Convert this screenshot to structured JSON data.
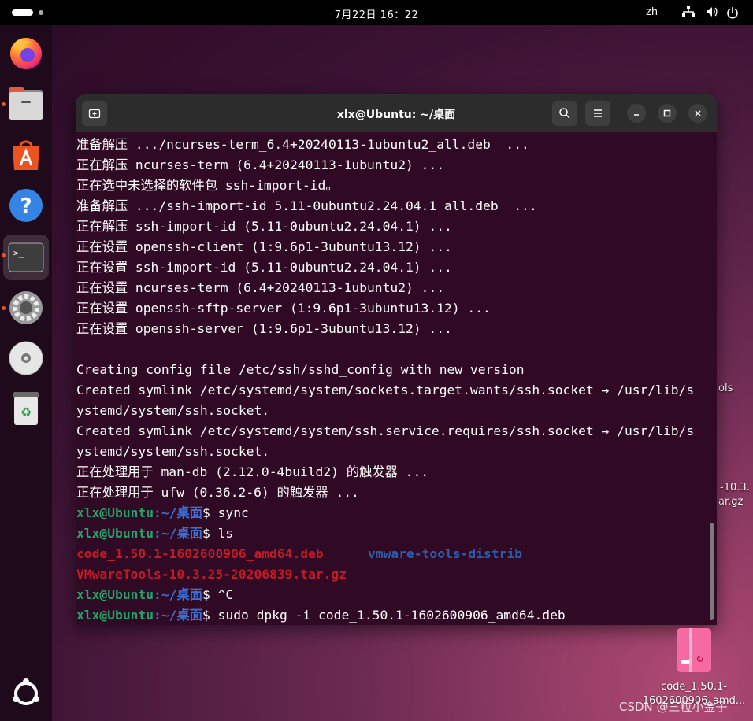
{
  "topbar": {
    "clock": "7月22日  16：22",
    "language": "zh"
  },
  "dock": {
    "items": [
      {
        "name": "firefox",
        "running": false
      },
      {
        "name": "files",
        "running": true
      },
      {
        "name": "app-center",
        "running": false
      },
      {
        "name": "help",
        "running": false
      },
      {
        "name": "terminal",
        "running": true,
        "active": true
      },
      {
        "name": "settings",
        "running": true
      },
      {
        "name": "disc",
        "running": false
      },
      {
        "name": "trash",
        "running": false
      }
    ]
  },
  "terminal": {
    "title": "xlx@Ubuntu: ~/桌面",
    "prompt_user": "xlx@Ubuntu",
    "prompt_path": ":~/桌面",
    "lines": [
      "准备解压 .../ncurses-term_6.4+20240113-1ubuntu2_all.deb  ...",
      "正在解压 ncurses-term (6.4+20240113-1ubuntu2) ...",
      "正在选中未选择的软件包 ssh-import-id。",
      "准备解压 .../ssh-import-id_5.11-0ubuntu2.24.04.1_all.deb  ...",
      "正在解压 ssh-import-id (5.11-0ubuntu2.24.04.1) ...",
      "正在设置 openssh-client (1:9.6p1-3ubuntu13.12) ...",
      "正在设置 ssh-import-id (5.11-0ubuntu2.24.04.1) ...",
      "正在设置 ncurses-term (6.4+20240113-1ubuntu2) ...",
      "正在设置 openssh-sftp-server (1:9.6p1-3ubuntu13.12) ...",
      "正在设置 openssh-server (1:9.6p1-3ubuntu13.12) ...",
      "",
      "Creating config file /etc/ssh/sshd_config with new version",
      "Created symlink /etc/systemd/system/sockets.target.wants/ssh.socket → /usr/lib/s",
      "ystemd/system/ssh.socket.",
      "Created symlink /etc/systemd/system/ssh.service.requires/ssh.socket → /usr/lib/s",
      "ystemd/system/ssh.socket.",
      "正在处理用于 man-db (2.12.0-4build2) 的触发器 ...",
      "正在处理用于 ufw (0.36.2-6) 的触发器 ..."
    ],
    "cmd_sync": "$ sync",
    "cmd_ls": "$ ls",
    "ls_file1": "code_1.50.1-1602600906_amd64.deb",
    "ls_dir": "vmware-tools-distrib",
    "ls_file2": "VMwareTools-10.3.25-20206839.tar.gz",
    "cmd_ctrlc": "$ ^C",
    "cmd_dpkg": "$ sudo dpkg -i code_1.50.1-1602600906_amd64.deb"
  },
  "desktop": {
    "deb_label": "code_1.50.1-1602600906_amd...",
    "peek_tools": "ols",
    "peek_tar_1": "-10.3.",
    "peek_tar_2": "ar.gz"
  },
  "watermark": "CSDN @三粒小金子",
  "colors": {
    "terminal_bg": "#300a24",
    "prompt_user": "#26a269",
    "prompt_path": "#3b6fd3",
    "archive": "#c01c28",
    "directory": "#2a5dae"
  }
}
